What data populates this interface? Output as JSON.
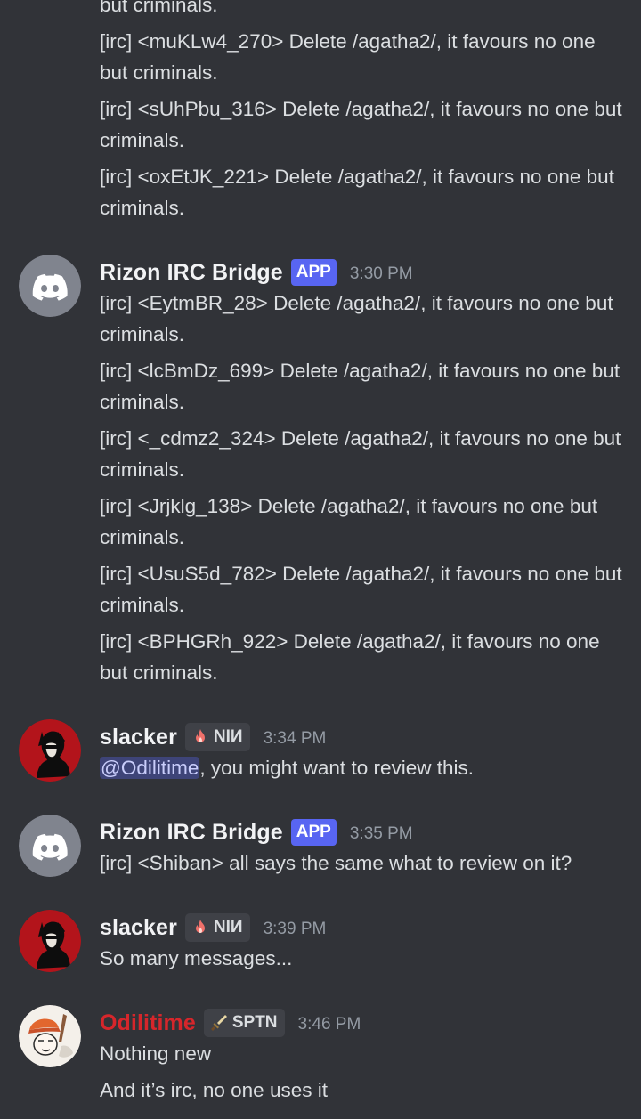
{
  "channel": {
    "groups": [
      {
        "id": "g0",
        "messages": [
          "but criminals.",
          "[irc] <muKLw4_270> Delete /agatha2/, it favours no one but criminals.",
          "[irc] <sUhPbu_316> Delete /agatha2/, it favours no one but criminals.",
          "[irc] <oxEtJK_221> Delete /agatha2/, it favours no one but criminals."
        ]
      },
      {
        "id": "g1",
        "author": "Rizon IRC Bridge",
        "badge": "APP",
        "time": "3:30 PM",
        "avatar_icon": "discord-logo-icon",
        "messages": [
          "[irc] <EytmBR_28> Delete /agatha2/, it favours no one but criminals.",
          "[irc] <lcBmDz_699> Delete /agatha2/, it favours no one but criminals.",
          "[irc] <_cdmz2_324> Delete /agatha2/, it favours no one but criminals.",
          "[irc] <Jrjklg_138> Delete /agatha2/, it favours no one but criminals.",
          "[irc] <UsuS5d_782> Delete /agatha2/, it favours no one but criminals.",
          "[irc] <BPHGRh_922> Delete /agatha2/, it favours no one but criminals."
        ]
      },
      {
        "id": "g2",
        "author": "slacker",
        "role_tag": "NIИ",
        "role_icon": "fire-icon",
        "time": "3:34 PM",
        "mention": "@Odilitime",
        "messages": [
          ", you might want to review this."
        ]
      },
      {
        "id": "g3",
        "author": "Rizon IRC Bridge",
        "badge": "APP",
        "time": "3:35 PM",
        "avatar_icon": "discord-logo-icon",
        "messages": [
          "[irc] <Shiban> all says the same what to review on it?"
        ]
      },
      {
        "id": "g4",
        "author": "slacker",
        "role_tag": "NIИ",
        "role_icon": "fire-icon",
        "time": "3:39 PM",
        "messages": [
          "So many messages..."
        ]
      },
      {
        "id": "g5",
        "author": "Odilitime",
        "author_color": "#d6262b",
        "role_tag": "SPTN",
        "role_icon": "sword-icon",
        "time": "3:46 PM",
        "messages": [
          "Nothing new",
          "And it’s irc, no one uses it"
        ]
      }
    ]
  },
  "colors": {
    "background": "#313338",
    "app_badge": "#5865f2",
    "discord_avatar": "#80848e",
    "role_tag_bg": "#3f4147"
  }
}
